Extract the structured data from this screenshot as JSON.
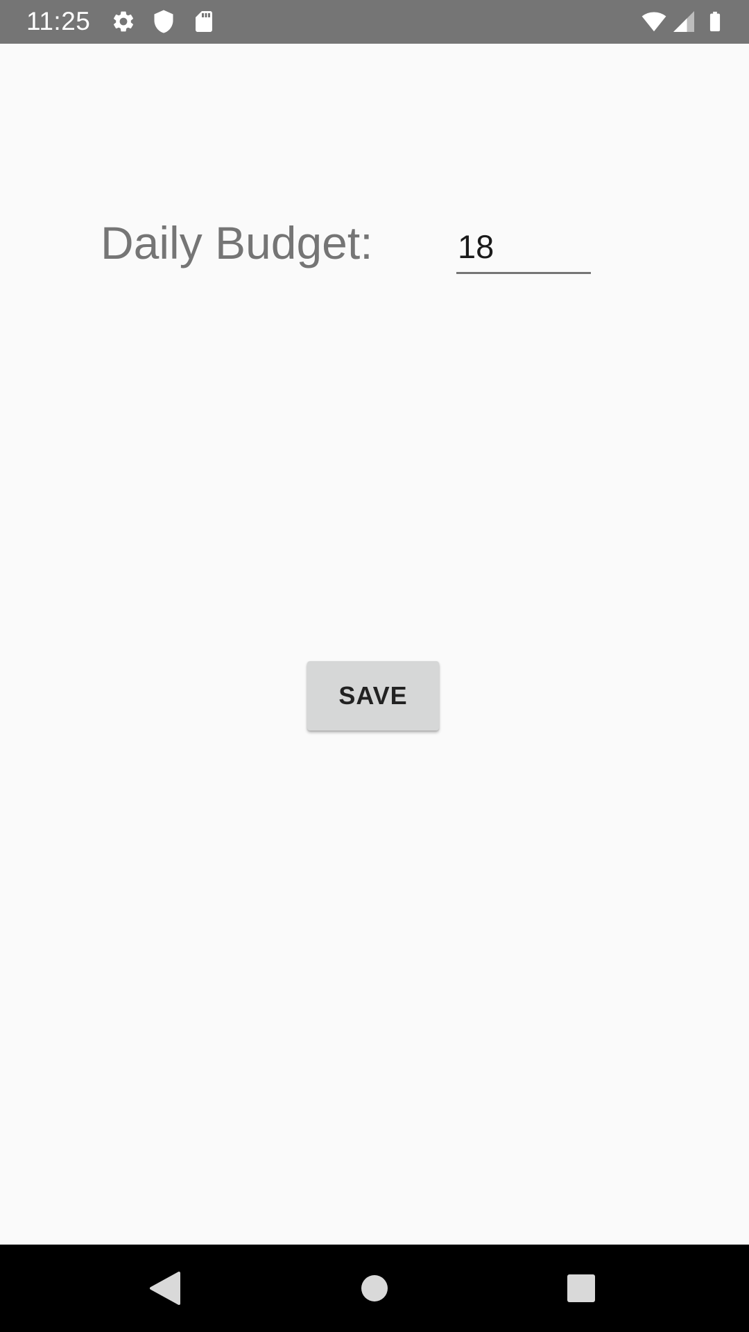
{
  "status_bar": {
    "time": "11:25",
    "icons": [
      "settings-icon",
      "shield-icon",
      "sd-card-icon",
      "wifi-icon",
      "signal-icon",
      "battery-icon"
    ],
    "background": "#757575"
  },
  "form": {
    "label": "Daily Budget:",
    "budget_value": "18"
  },
  "actions": {
    "save_label": "SAVE"
  },
  "nav_bar": {
    "buttons": [
      "back-icon",
      "home-icon",
      "recents-icon"
    ],
    "background": "#000000"
  },
  "colors": {
    "page_background": "#fafafa",
    "button_background": "#d6d7d7",
    "label_text": "#757575"
  }
}
